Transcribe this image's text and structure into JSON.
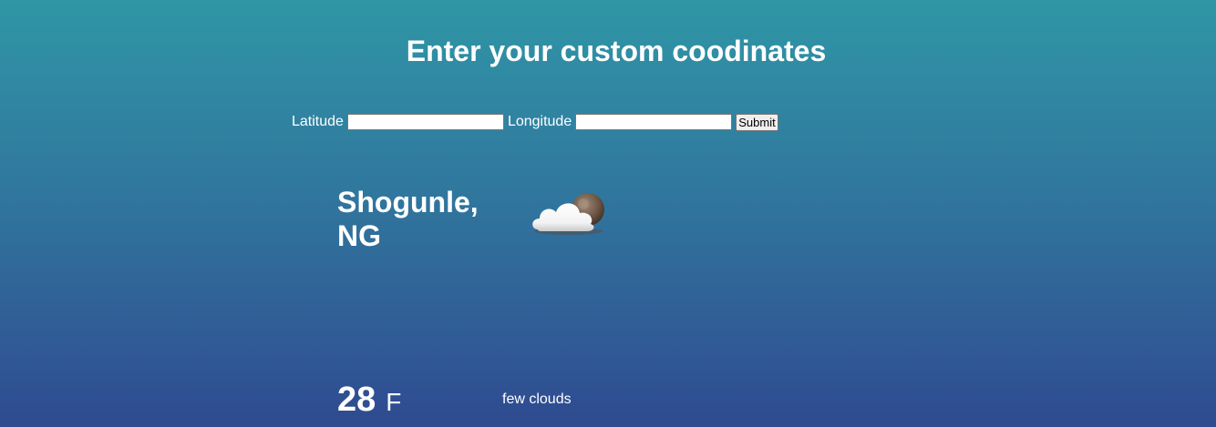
{
  "header": {
    "title": "Enter your custom coodinates"
  },
  "form": {
    "latitude_label": "Latitude",
    "latitude_value": "",
    "longitude_label": "Longitude",
    "longitude_value": "",
    "submit_label": "Submit"
  },
  "weather": {
    "location": "Shogunle, NG",
    "icon": "few-clouds-night-icon",
    "temperature": "28",
    "unit": "F",
    "description": "few clouds"
  },
  "colors": {
    "gradient_top": "#2f96a6",
    "gradient_bottom": "#2f4a90",
    "text": "#ffffff"
  }
}
